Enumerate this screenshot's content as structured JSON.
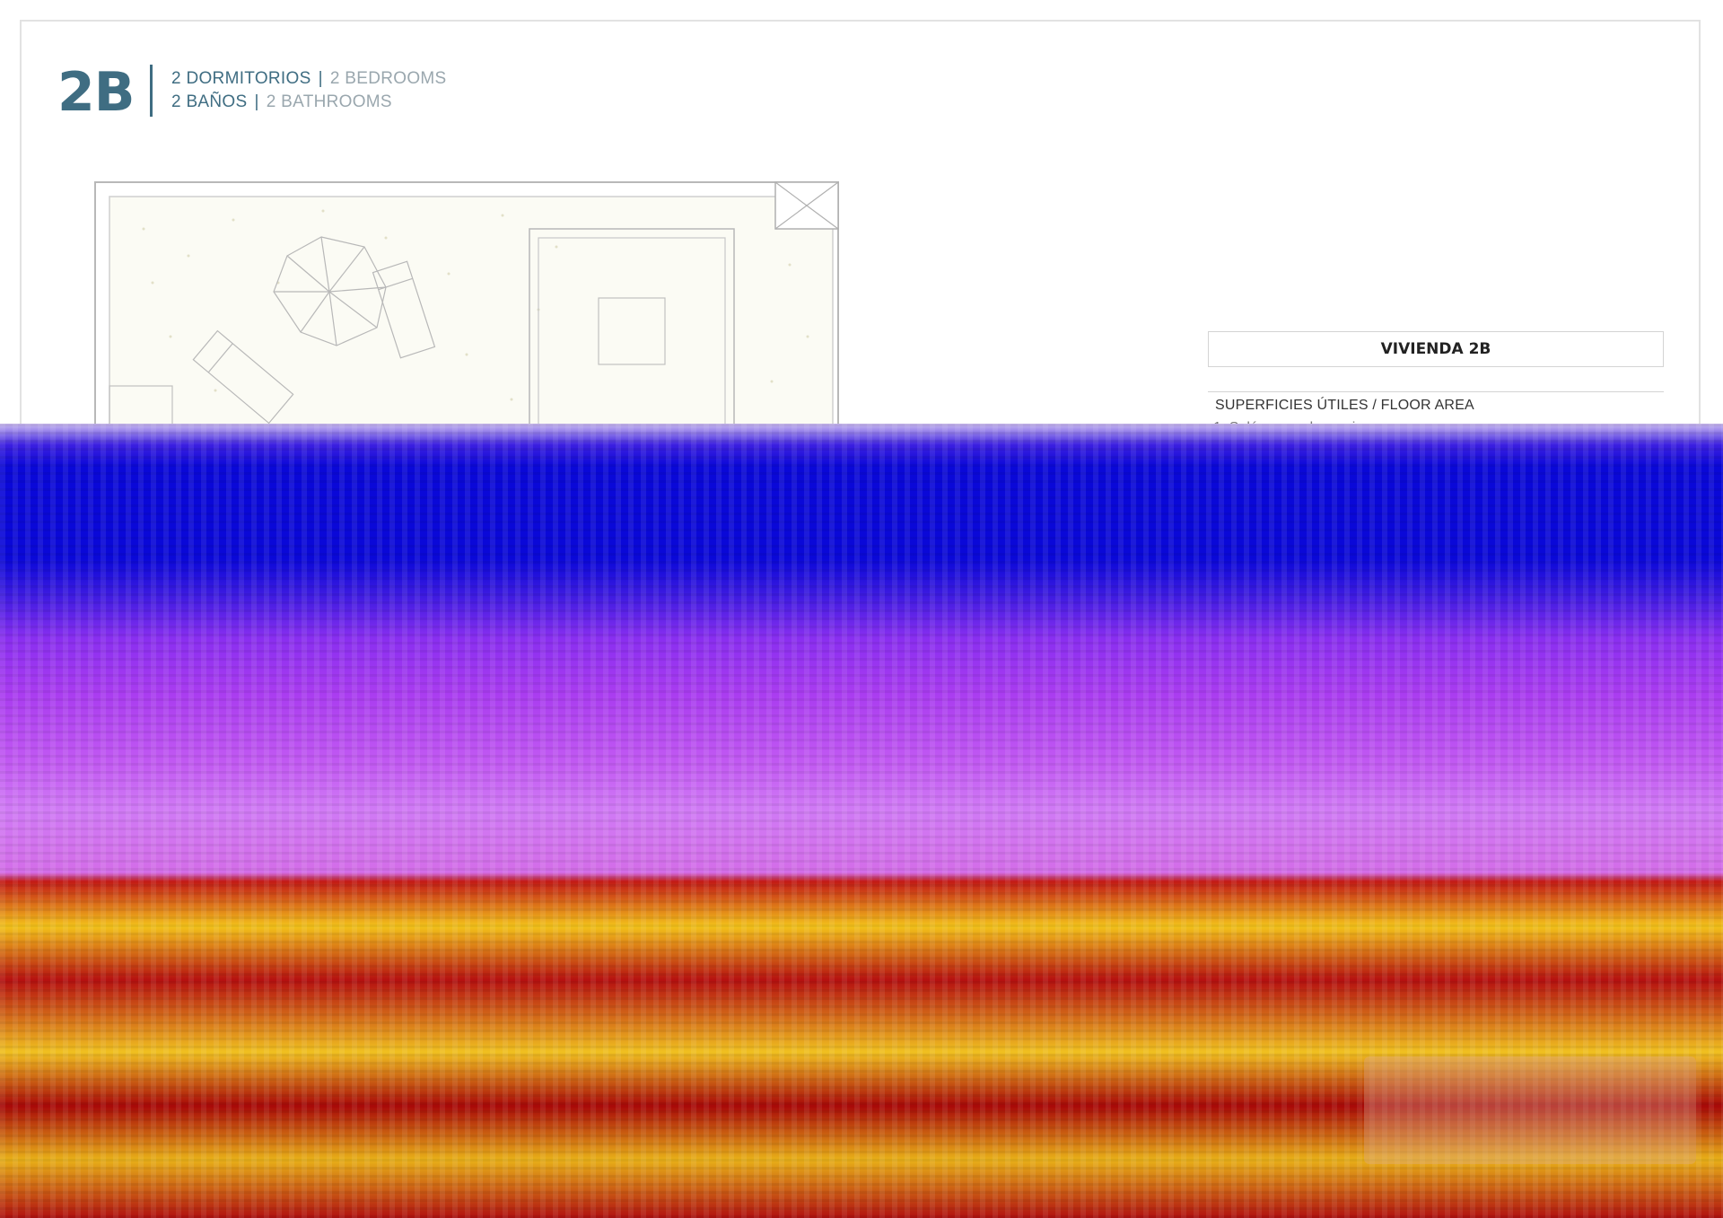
{
  "unit": {
    "code": "2B",
    "bedrooms_es": "2 DORMITORIOS",
    "bedrooms_en": "2 BEDROOMS",
    "bathrooms_es": "2 BAÑOS",
    "bathrooms_en": "2 BATHROOMS",
    "separator": "|"
  },
  "table": {
    "title": "VIVIENDA 2B",
    "header": "SUPERFICIES ÚTILES / FLOOR AREA",
    "rows": [
      "1. Salón comedor cocina"
    ]
  },
  "colors": {
    "brand": "#3f6d82",
    "muted": "#9aa7ae"
  }
}
